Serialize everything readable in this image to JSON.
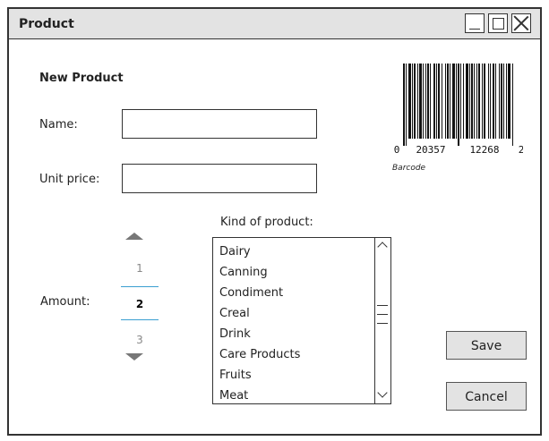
{
  "window": {
    "title": "Product"
  },
  "form": {
    "heading": "New Product",
    "name_label": "Name:",
    "name_value": "",
    "unit_price_label": "Unit price:",
    "unit_price_value": "",
    "amount_label": "Amount:",
    "amount": {
      "prev": "1",
      "current": "2",
      "next": "3"
    },
    "kind_label": "Kind of product:",
    "kinds": [
      "Dairy",
      "Canning",
      "Condiment",
      "Creal",
      "Drink",
      "Care Products",
      "Fruits",
      "Meat"
    ]
  },
  "barcode": {
    "digits_left": "0",
    "digits_group1": "20357",
    "digits_group2": "12268",
    "digits_right": "2",
    "caption": "Barcode"
  },
  "buttons": {
    "save": "Save",
    "cancel": "Cancel"
  },
  "icons": {
    "minimize": "minimize-icon",
    "maximize": "maximize-icon",
    "close": "close-icon",
    "step_up": "triangle-up-icon",
    "step_down": "triangle-down-icon",
    "scroll_up": "chevron-up-icon",
    "scroll_down": "chevron-down-icon"
  }
}
